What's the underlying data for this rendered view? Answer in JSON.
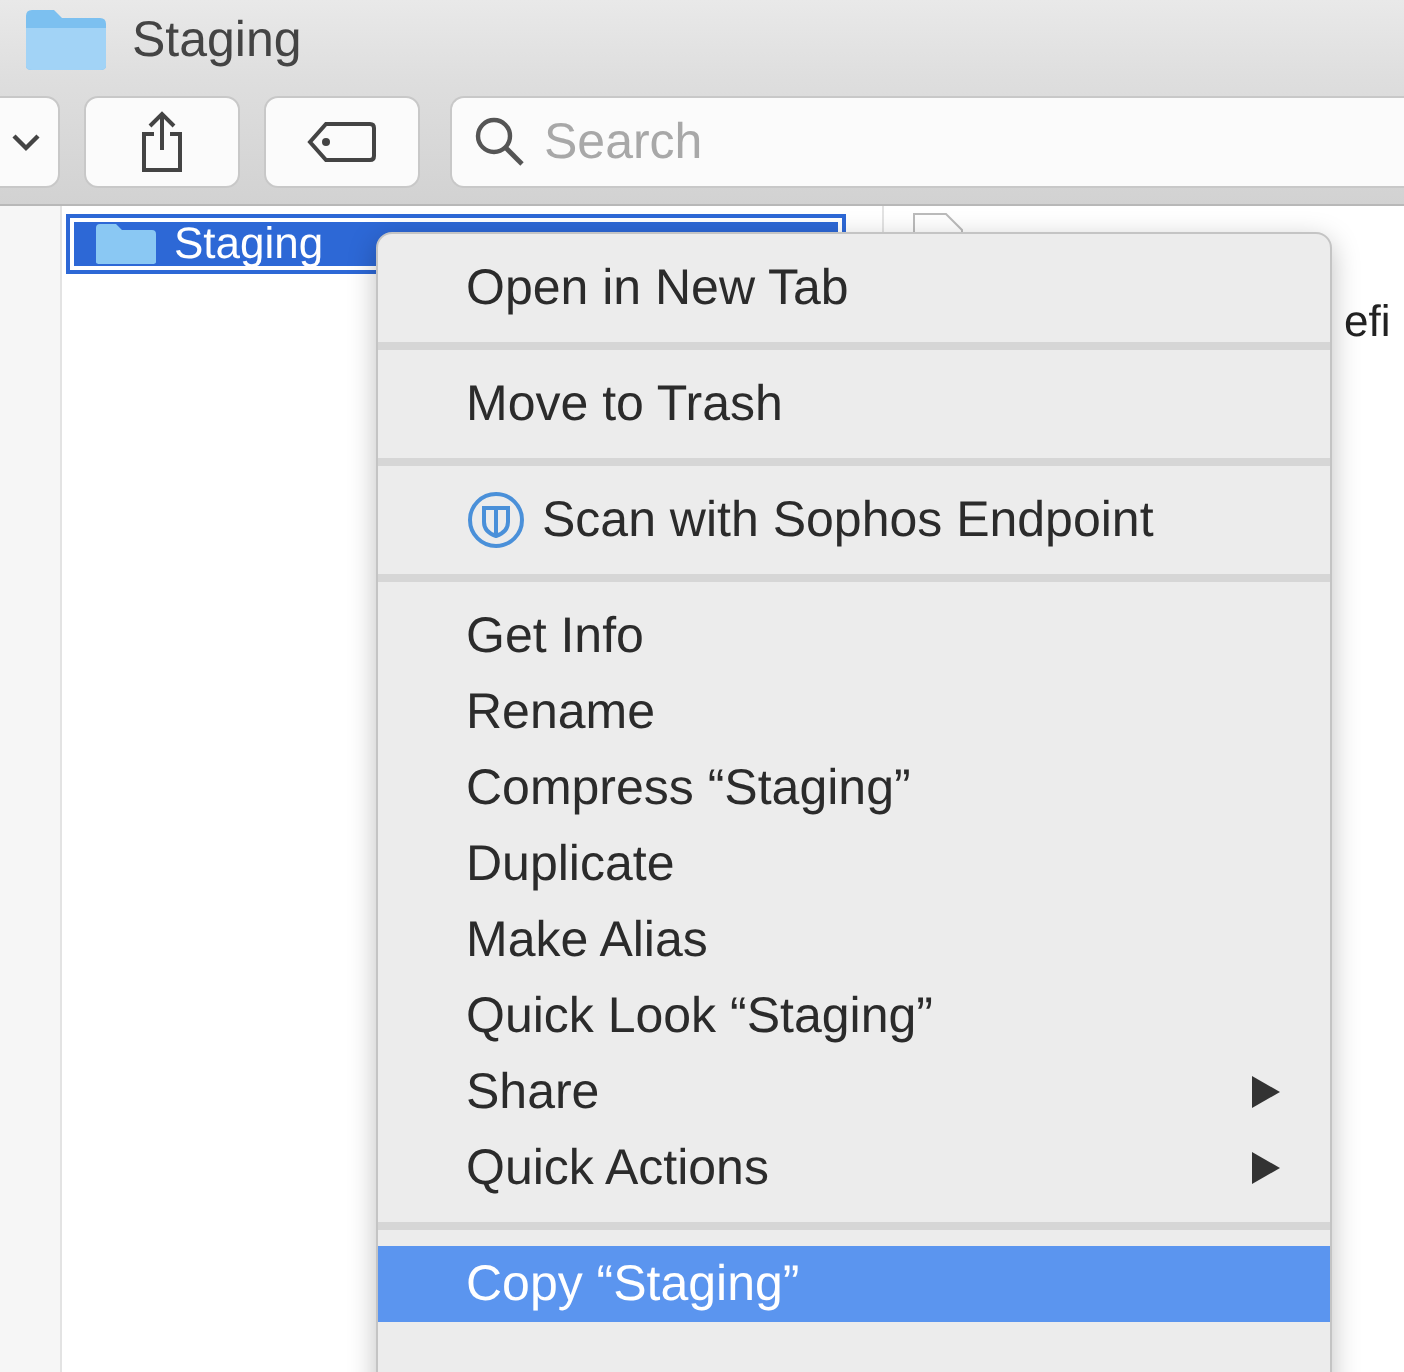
{
  "window": {
    "title": "Staging"
  },
  "search": {
    "placeholder": "Search"
  },
  "column_1": {
    "items": [
      {
        "name": "Staging",
        "selected": true
      }
    ]
  },
  "column_2": {
    "items": [
      {
        "name": "efi"
      }
    ]
  },
  "context_menu": {
    "groups": [
      [
        {
          "label": "Open in New Tab",
          "kind": "plain",
          "selected": false
        }
      ],
      [
        {
          "label": "Move to Trash",
          "kind": "plain",
          "selected": false
        }
      ],
      [
        {
          "label": "Scan with Sophos Endpoint",
          "kind": "icon",
          "selected": false
        }
      ],
      [
        {
          "label": "Get Info",
          "kind": "plain",
          "selected": false
        },
        {
          "label": "Rename",
          "kind": "plain",
          "selected": false
        },
        {
          "label": "Compress “Staging”",
          "kind": "plain",
          "selected": false
        },
        {
          "label": "Duplicate",
          "kind": "plain",
          "selected": false
        },
        {
          "label": "Make Alias",
          "kind": "plain",
          "selected": false
        },
        {
          "label": "Quick Look “Staging”",
          "kind": "plain",
          "selected": false
        },
        {
          "label": "Share",
          "kind": "submenu",
          "selected": false
        },
        {
          "label": "Quick Actions",
          "kind": "submenu",
          "selected": false
        }
      ],
      [
        {
          "label": "Copy “Staging”",
          "kind": "plain",
          "selected": true
        }
      ]
    ]
  }
}
